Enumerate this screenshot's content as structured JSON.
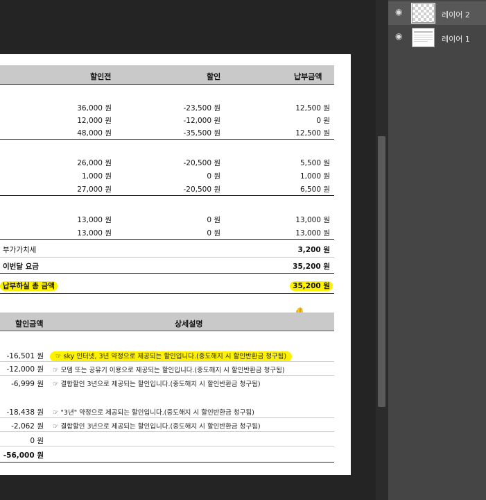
{
  "invoice": {
    "headers": {
      "before": "할인전",
      "discount": "할인",
      "payment": "납부금액"
    },
    "groups": [
      [
        {
          "before": "36,000 원",
          "discount": "-23,500 원",
          "payment": "12,500 원"
        },
        {
          "before": "12,000 원",
          "discount": "-12,000 원",
          "payment": "0 원"
        },
        {
          "before": "48,000 원",
          "discount": "-35,500 원",
          "payment": "12,500 원"
        }
      ],
      [
        {
          "before": "26,000 원",
          "discount": "-20,500 원",
          "payment": "5,500 원"
        },
        {
          "before": "1,000 원",
          "discount": "0 원",
          "payment": "1,000 원"
        },
        {
          "before": "27,000 원",
          "discount": "-20,500 원",
          "payment": "6,500 원"
        }
      ],
      [
        {
          "before": "13,000 원",
          "discount": "0 원",
          "payment": "13,000 원"
        },
        {
          "before": "13,000 원",
          "discount": "0 원",
          "payment": "13,000 원"
        }
      ]
    ],
    "vat_label": "부가가치세",
    "vat_value": "3,200 원",
    "month_label": "이번달 요금",
    "month_value": "35,200 원",
    "total_label": "납부하실 총 금액",
    "total_value": "35,200 원"
  },
  "discount_table": {
    "headers": {
      "amount": "할인금액",
      "detail": "상세설명"
    },
    "rows": [
      {
        "amount": "-16,501 원",
        "detail": "☞ sky 인터넷, 3년 약정으로 제공되는 할인입니다.(중도해지 시 할인반환금 청구됨)"
      },
      {
        "amount": "-12,000 원",
        "detail": "☞ 모뎀 또는 공유기 이용으로 제공되는 할인입니다.(중도해지 시 할인반환금 청구됨)"
      },
      {
        "amount": "-6,999 원",
        "detail": "☞ 결합할인 3년으로 제공되는 할인입니다.(중도해지 시 할인반환금 청구됨)"
      },
      {
        "amount": "-18,438 원",
        "detail": "☞ \"3년\" 약정으로 제공되는 할인입니다.(중도해지 시 할인반환금 청구됨)"
      },
      {
        "amount": "-2,062 원",
        "detail": "☞ 결합할인 3년으로 제공되는 할인입니다.(중도해지 시 할인반환금 청구됨)"
      },
      {
        "amount": "0 원",
        "detail": ""
      }
    ],
    "total": "-56,000 원"
  },
  "layers": [
    {
      "name": "레이어 2",
      "selected": true
    },
    {
      "name": "레이어 1",
      "selected": false
    }
  ],
  "icons": {
    "visibility": "eye-icon",
    "cursor": "hand-grab-icon"
  },
  "colors": {
    "highlight": "#fff200",
    "header_bg": "#c9c9c9",
    "panel_bg": "#454545"
  }
}
